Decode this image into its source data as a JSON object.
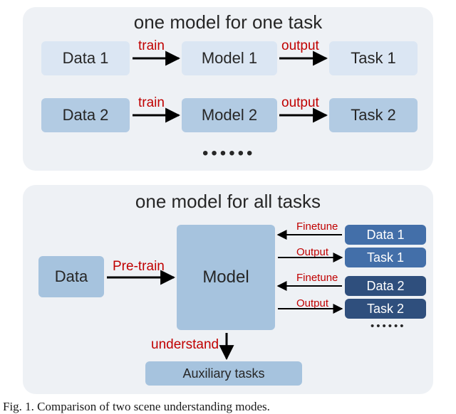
{
  "top": {
    "title": "one model for one task",
    "row1": {
      "data": "Data 1",
      "model": "Model 1",
      "task": "Task 1",
      "edge1": "train",
      "edge2": "output"
    },
    "row2": {
      "data": "Data 2",
      "model": "Model 2",
      "task": "Task 2",
      "edge1": "train",
      "edge2": "output"
    },
    "dots": "••••••"
  },
  "bottom": {
    "title": "one model for all tasks",
    "data": "Data",
    "model": "Model",
    "pretrain": "Pre-train",
    "understand": "understand",
    "aux": "Auxiliary tasks",
    "r1": {
      "ft": "Finetune",
      "out": "Output",
      "data": "Data 1",
      "task": "Task 1"
    },
    "r2": {
      "ft": "Finetune",
      "out": "Output",
      "data": "Data 2",
      "task": "Task 2"
    },
    "dots": "••••••"
  },
  "caption": "Fig. 1. Comparison of two scene understanding modes."
}
